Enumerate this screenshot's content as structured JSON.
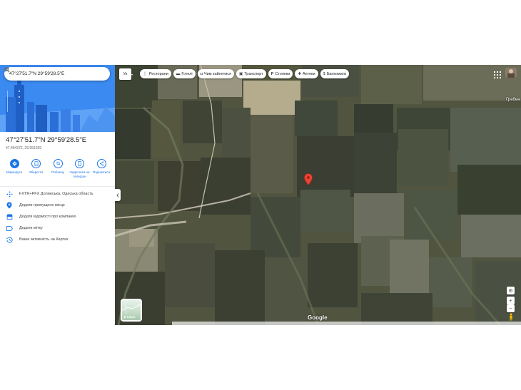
{
  "search": {
    "query": "47°27'51.7\"N 29°59'28.5\"E"
  },
  "place": {
    "title": "47°27'51.7\"N 29°59'28.5\"E",
    "coords": "47.464372, 29.991259",
    "actions": [
      {
        "label": "Маршрути",
        "icon": "directions-icon"
      },
      {
        "label": "Зберегти",
        "icon": "bookmark-icon"
      },
      {
        "label": "Поблизу",
        "icon": "nearby-icon"
      },
      {
        "label": "Надіслати на телефон",
        "icon": "phone-icon"
      },
      {
        "label": "Поділитися",
        "icon": "share-icon"
      }
    ],
    "info": [
      {
        "text": "FXTR+PFX Долинська, Одеська область",
        "icon": "plus-code-icon"
      },
      {
        "text": "Додати пропущене місце",
        "icon": "add-place-icon"
      },
      {
        "text": "Додати відомості про компанію",
        "icon": "business-icon"
      },
      {
        "text": "Додати мітку",
        "icon": "label-icon"
      },
      {
        "text": "Ваша активність на Картах",
        "icon": "history-icon"
      }
    ]
  },
  "map": {
    "lang_button": "Ук",
    "chips": [
      {
        "label": "Ресторани",
        "icon": "restaurant-icon"
      },
      {
        "label": "Готелі",
        "icon": "hotel-icon"
      },
      {
        "label": "Чим зайнятися",
        "icon": "camera-icon"
      },
      {
        "label": "Транспорт",
        "icon": "transit-icon"
      },
      {
        "label": "Стоянки",
        "icon": "parking-icon"
      },
      {
        "label": "Аптеки",
        "icon": "pharmacy-icon"
      },
      {
        "label": "Банкомати",
        "icon": "atm-icon"
      }
    ],
    "town_label": "Гребен",
    "layer_label": "Шари",
    "logo": "Google",
    "accent": "#1a73e8",
    "marker_color": "#ea4335"
  }
}
